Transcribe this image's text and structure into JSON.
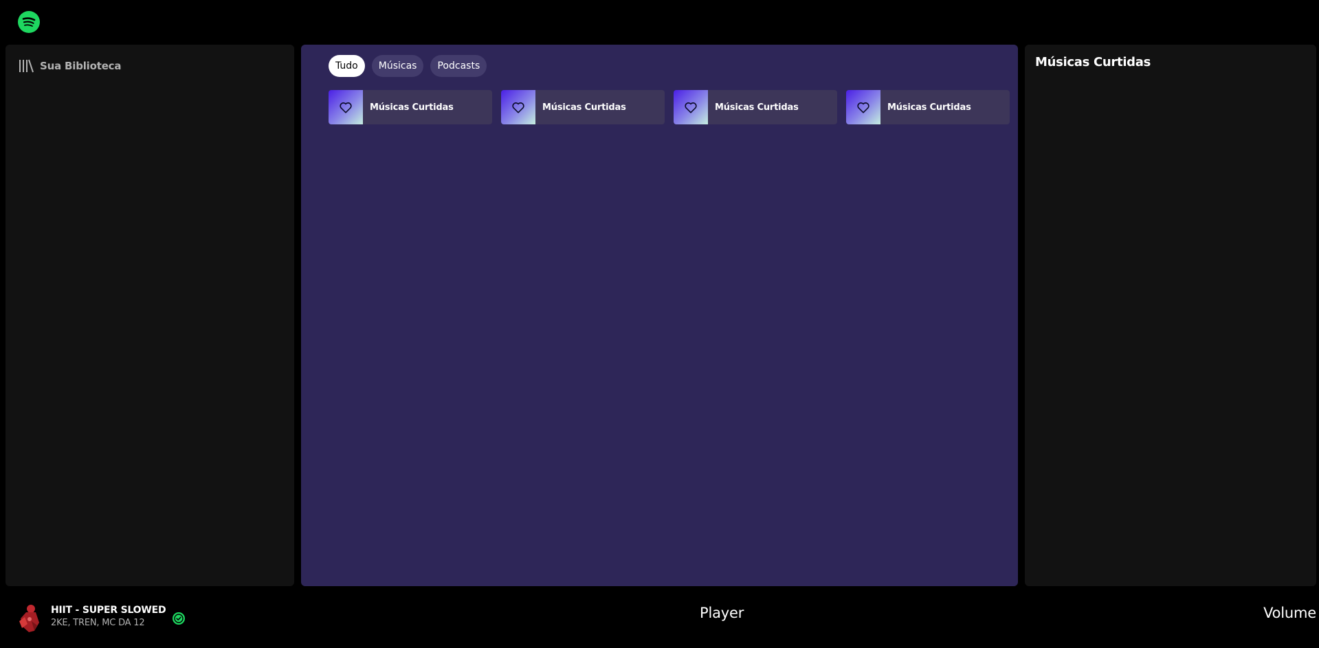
{
  "app": {
    "logo_icon": "spotify-logo-icon",
    "accent_color": "#1ed760"
  },
  "library": {
    "title": "Sua Biblioteca",
    "icon": "library-icon"
  },
  "filters": {
    "chips": [
      {
        "label": "Tudo",
        "active": true
      },
      {
        "label": "Músicas",
        "active": false
      },
      {
        "label": "Podcasts",
        "active": false
      }
    ]
  },
  "main": {
    "background_color": "#2e2658",
    "cards": [
      {
        "title": "Músicas Curtidas",
        "icon": "heart-icon"
      },
      {
        "title": "Músicas Curtidas",
        "icon": "heart-icon"
      },
      {
        "title": "Músicas Curtidas",
        "icon": "heart-icon"
      },
      {
        "title": "Músicas Curtidas",
        "icon": "heart-icon"
      }
    ]
  },
  "right_panel": {
    "title": "Músicas Curtidas"
  },
  "player_bar": {
    "now_playing": {
      "title": "HIIT - SUPER SLOWED",
      "artists": "2KE, TREN, MC DA 12",
      "saved_icon": "check-circle-icon"
    },
    "player_label": "Player",
    "volume_label": "Volume"
  }
}
